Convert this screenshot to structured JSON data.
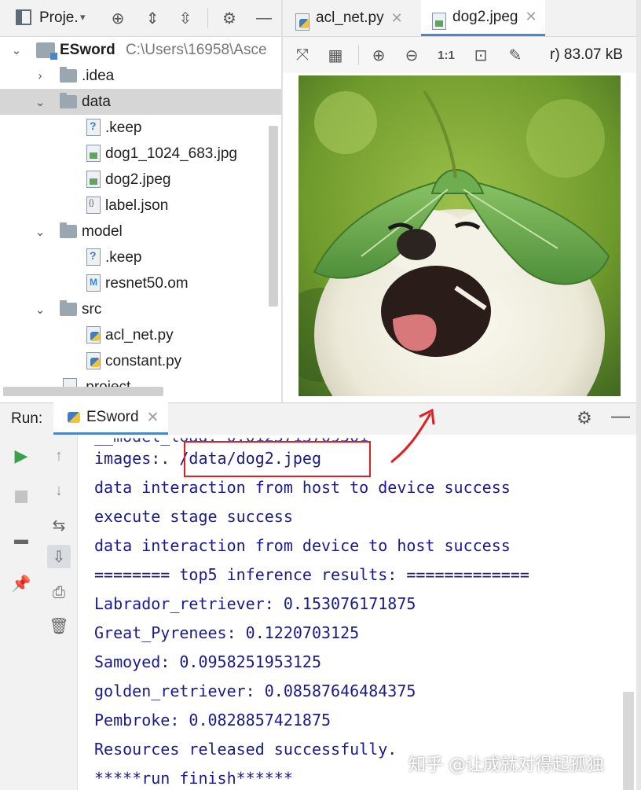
{
  "project_panel": {
    "title": "Proje.",
    "tree": [
      {
        "label": "ESword",
        "path": "C:\\Users\\16958\\Asce",
        "level": 0,
        "expanded": true,
        "type": "module"
      },
      {
        "label": ".idea",
        "level": 1,
        "expanded": false,
        "type": "folder"
      },
      {
        "label": "data",
        "level": 1,
        "expanded": true,
        "type": "folder",
        "selected": true
      },
      {
        "label": ".keep",
        "level": 2,
        "type": "keep"
      },
      {
        "label": "dog1_1024_683.jpg",
        "level": 2,
        "type": "img"
      },
      {
        "label": "dog2.jpeg",
        "level": 2,
        "type": "img"
      },
      {
        "label": "label.json",
        "level": 2,
        "type": "json"
      },
      {
        "label": "model",
        "level": 1,
        "expanded": true,
        "type": "folder"
      },
      {
        "label": ".keep",
        "level": 2,
        "type": "keep"
      },
      {
        "label": "resnet50.om",
        "level": 2,
        "type": "om"
      },
      {
        "label": "src",
        "level": 1,
        "expanded": true,
        "type": "folder"
      },
      {
        "label": "acl_net.py",
        "level": 2,
        "type": "py"
      },
      {
        "label": "constant.py",
        "level": 2,
        "type": "py"
      },
      {
        "label": ".project",
        "level": 1,
        "type": "module"
      }
    ]
  },
  "editor": {
    "tabs": [
      {
        "label": "acl_net.py",
        "active": false
      },
      {
        "label": "dog2.jpeg",
        "active": true
      }
    ],
    "image_info": "r) 83.07 kB",
    "zoom_actual_label": "1:1"
  },
  "run_panel": {
    "title": "Run:",
    "tab_label": "ESword",
    "console_lines": [
      "images:. /data/dog2.jpeg",
      "data interaction from host to device success",
      "execute stage success",
      "data interaction from device to host success",
      "======== top5 inference results: =============",
      "Labrador_retriever: 0.153076171875",
      "Great_Pyrenees: 0.1220703125",
      "Samoyed: 0.0958251953125",
      "golden_retriever: 0.08587646484375",
      "Pembroke: 0.0828857421875",
      "Resources released successfully.",
      "*****run finish******"
    ]
  },
  "watermark": "知乎 @让成就对得起孤独",
  "colors": {
    "console_text": "#1a1a8c",
    "highlight": "#e02020",
    "accent": "#4a87c8",
    "run_green": "#3aa14a"
  }
}
